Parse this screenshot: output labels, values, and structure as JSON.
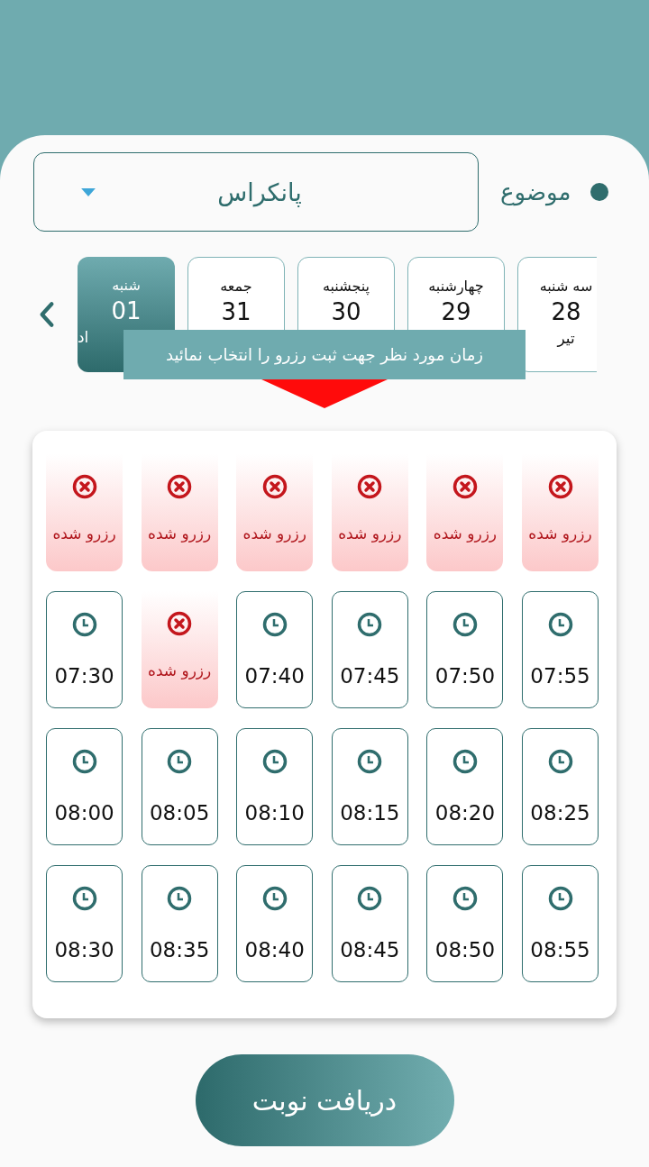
{
  "subject": {
    "label": "موضوع",
    "value": "پانکراس"
  },
  "days": [
    {
      "weekday": "سه شنبه",
      "date": "28",
      "month": "تیر",
      "selected": false,
      "month_cut": false
    },
    {
      "weekday": "چهارشنبه",
      "date": "29",
      "selected": false
    },
    {
      "weekday": "پنجشنبه",
      "date": "30",
      "selected": false
    },
    {
      "weekday": "جمعه",
      "date": "31",
      "selected": false
    },
    {
      "weekday": "شنبه",
      "date": "01",
      "month": "اد",
      "selected": true,
      "month_cut": true
    }
  ],
  "tooltip": "زمان مورد نظر جهت ثبت رزرو را انتخاب نمائید",
  "slots": [
    {
      "kind": "reserved",
      "label": "رزرو شده"
    },
    {
      "kind": "reserved",
      "label": "رزرو شده"
    },
    {
      "kind": "reserved",
      "label": "رزرو شده"
    },
    {
      "kind": "reserved",
      "label": "رزرو شده"
    },
    {
      "kind": "reserved",
      "label": "رزرو شده"
    },
    {
      "kind": "reserved",
      "label": "رزرو شده"
    },
    {
      "kind": "free",
      "time": "07:55"
    },
    {
      "kind": "free",
      "time": "07:50"
    },
    {
      "kind": "free",
      "time": "07:45"
    },
    {
      "kind": "free",
      "time": "07:40"
    },
    {
      "kind": "reserved",
      "label": "رزرو شده"
    },
    {
      "kind": "free",
      "time": "07:30"
    },
    {
      "kind": "free",
      "time": "08:25"
    },
    {
      "kind": "free",
      "time": "08:20"
    },
    {
      "kind": "free",
      "time": "08:15"
    },
    {
      "kind": "free",
      "time": "08:10"
    },
    {
      "kind": "free",
      "time": "08:05"
    },
    {
      "kind": "free",
      "time": "08:00"
    },
    {
      "kind": "free",
      "time": "08:55"
    },
    {
      "kind": "free",
      "time": "08:50"
    },
    {
      "kind": "free",
      "time": "08:45"
    },
    {
      "kind": "free",
      "time": "08:40"
    },
    {
      "kind": "free",
      "time": "08:35"
    },
    {
      "kind": "free",
      "time": "08:30"
    }
  ],
  "submit_button": "دریافت نوبت"
}
